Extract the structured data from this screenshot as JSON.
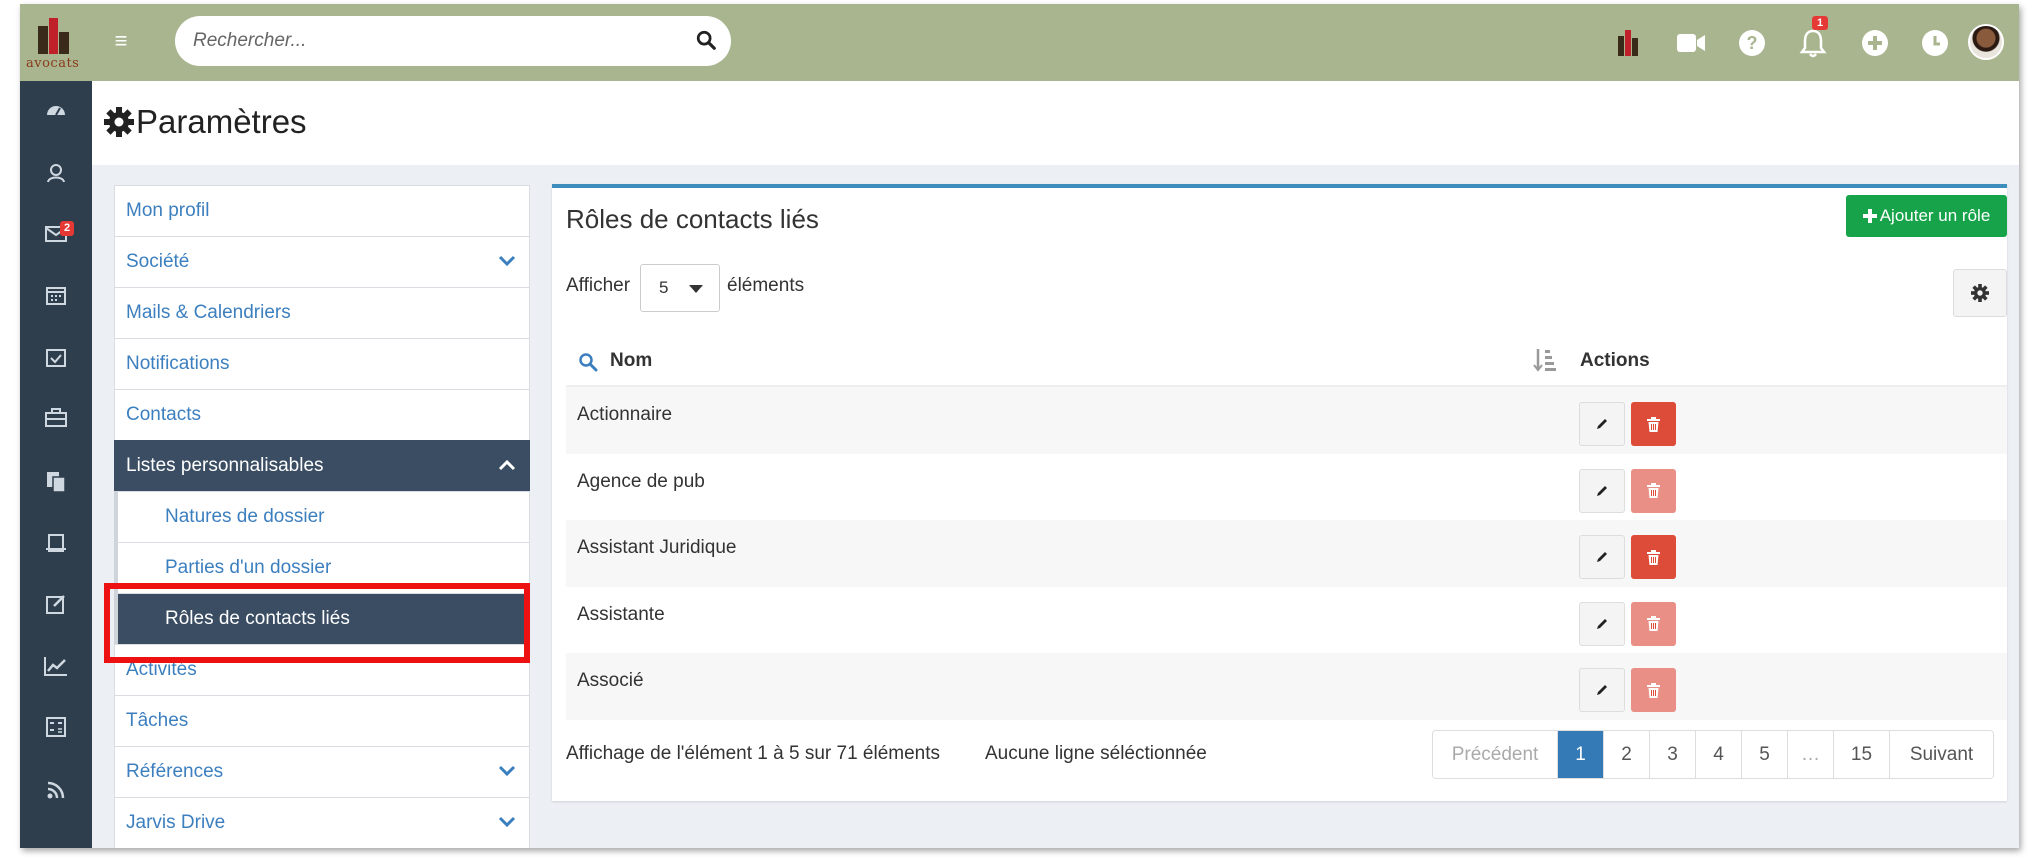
{
  "app": {
    "logo_text": "avocats"
  },
  "search": {
    "placeholder": "Rechercher..."
  },
  "topbar": {
    "notification_count": "1",
    "icons": [
      "logo-mini-icon",
      "video-icon",
      "help-icon",
      "bell-icon",
      "plus-circle-icon",
      "clock-icon",
      "user-avatar"
    ]
  },
  "sidebar": {
    "icons": [
      "dashboard-icon",
      "contacts-icon",
      "mail-icon",
      "calendar-icon",
      "tasks-icon",
      "briefcase-icon",
      "documents-icon",
      "billing-icon",
      "edit-icon",
      "chart-icon",
      "calculator-icon",
      "rss-icon"
    ],
    "mail_badge": "2"
  },
  "page": {
    "title": "Paramètres"
  },
  "settings_menu": {
    "items": [
      {
        "label": "Mon profil"
      },
      {
        "label": "Société"
      },
      {
        "label": "Mails & Calendriers"
      },
      {
        "label": "Notifications"
      },
      {
        "label": "Contacts"
      },
      {
        "label": "Listes personnalisables"
      },
      {
        "label": "Natures de dossier"
      },
      {
        "label": "Parties d'un dossier"
      },
      {
        "label": "Rôles de contacts liés"
      },
      {
        "label": "Activités"
      },
      {
        "label": "Tâches"
      },
      {
        "label": "Références"
      },
      {
        "label": "Jarvis Drive"
      }
    ]
  },
  "panel": {
    "title": "Rôles de contacts liés",
    "add_button": "Ajouter un rôle",
    "show_label": "Afficher",
    "page_length": "5",
    "elements_label": "éléments",
    "columns": {
      "name": "Nom",
      "actions": "Actions"
    },
    "rows": [
      {
        "name": "Actionnaire",
        "delete_enabled": true
      },
      {
        "name": "Agence de pub",
        "delete_enabled": false
      },
      {
        "name": "Assistant Juridique",
        "delete_enabled": true
      },
      {
        "name": "Assistante",
        "delete_enabled": false
      },
      {
        "name": "Associé",
        "delete_enabled": false
      }
    ],
    "info": "Affichage de l'élément 1 à 5 sur 71 éléments",
    "selection_info": "Aucune ligne séléctionnée",
    "pagination": [
      "Précédent",
      "1",
      "2",
      "3",
      "4",
      "5",
      "…",
      "15",
      "Suivant"
    ]
  },
  "colors": {
    "topbar": "#a8b58f",
    "sidebar": "#2f3e4d",
    "active_menu": "#3a4d63",
    "link": "#3c7fbf",
    "add_button": "#17a34a",
    "delete_button": "#dd4b39",
    "page_active": "#337ab7",
    "highlight": "#ee1111"
  }
}
